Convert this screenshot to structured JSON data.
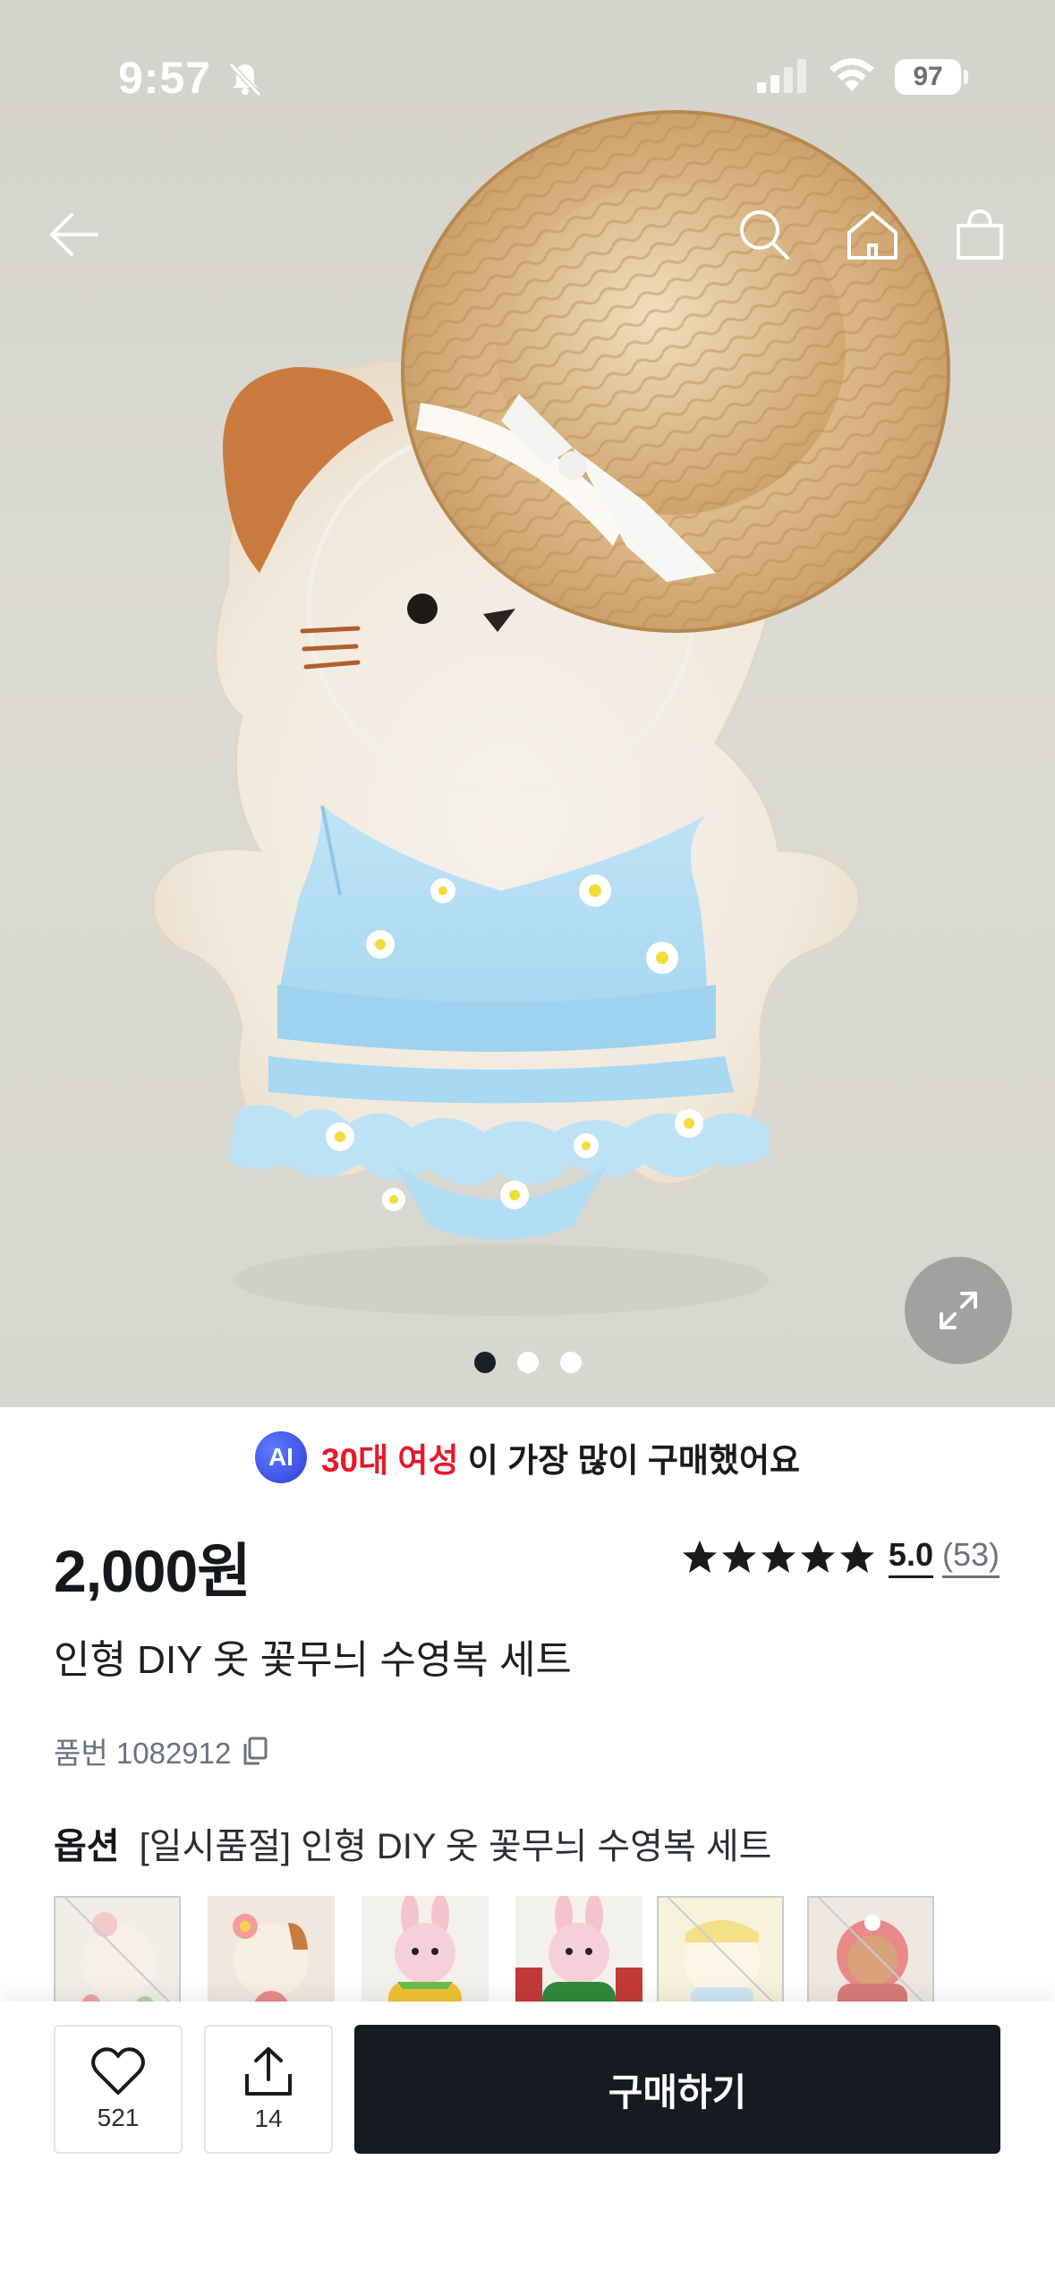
{
  "status_bar": {
    "time": "9:57",
    "battery": "97"
  },
  "nav": {
    "icons": [
      "back-arrow-icon",
      "search-icon",
      "home-icon",
      "shopping-bag-icon"
    ]
  },
  "gallery": {
    "image_count": 3,
    "active_index": 0
  },
  "ai_banner": {
    "badge": "AI",
    "highlight": "30대 여성",
    "text": " 이 가장 많이 구매했어요",
    "highlight_color": "#e5182c"
  },
  "product": {
    "price": "2,000원",
    "title": "인형 DIY 옷 꽃무늬 수영복 세트",
    "sku": "품번 1082912",
    "rating": {
      "stars": 5,
      "score": "5.0",
      "count": "(53)"
    }
  },
  "option": {
    "label": "옵션",
    "value": "[일시품절] 인형 DIY 옷 꽃무늬 수영복 세트",
    "thumbnails": [
      {
        "name": "option-thumb-1",
        "sold_out": true
      },
      {
        "name": "option-thumb-2",
        "sold_out": false
      },
      {
        "name": "option-thumb-3",
        "sold_out": false
      },
      {
        "name": "option-thumb-4",
        "sold_out": false
      },
      {
        "name": "option-thumb-5",
        "sold_out": true
      },
      {
        "name": "option-thumb-6",
        "sold_out": true
      }
    ]
  },
  "actions": {
    "likes": "521",
    "shares": "14",
    "buy_label": "구매하기"
  },
  "colors": {
    "dark": "#161a21",
    "accent_red": "#e5182c",
    "ai_blue": "#2d3fd6"
  }
}
